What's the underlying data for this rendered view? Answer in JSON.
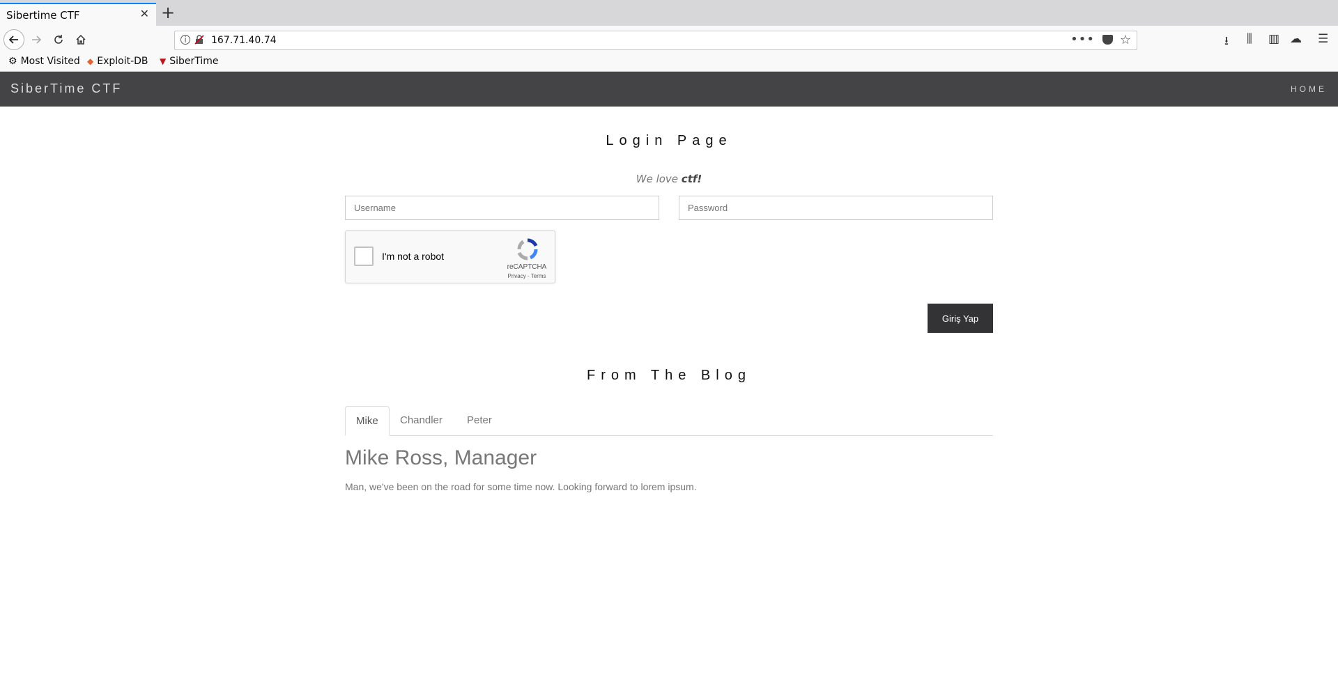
{
  "browser": {
    "tab_title": "Sibertime CTF",
    "url": "167.71.40.74",
    "bookmarks": [
      "Most Visited",
      "Exploit-DB",
      "SiberTime"
    ]
  },
  "site": {
    "brand": "SiberTime CTF",
    "nav_home": "HOME"
  },
  "login": {
    "title": "Login Page",
    "tagline_prefix": "We love ",
    "tagline_bold": "ctf!",
    "username_placeholder": "Username",
    "password_placeholder": "Password",
    "submit_label": "Giriş Yap"
  },
  "recaptcha": {
    "label": "I'm not a robot",
    "brand": "reCAPTCHA",
    "links": "Privacy - Terms"
  },
  "blog": {
    "title": "From The Blog",
    "tabs": [
      "Mike",
      "Chandler",
      "Peter"
    ],
    "active_tab": "Mike",
    "heading": "Mike Ross, Manager",
    "text": "Man, we've been on the road for some time now. Looking forward to lorem ipsum."
  }
}
